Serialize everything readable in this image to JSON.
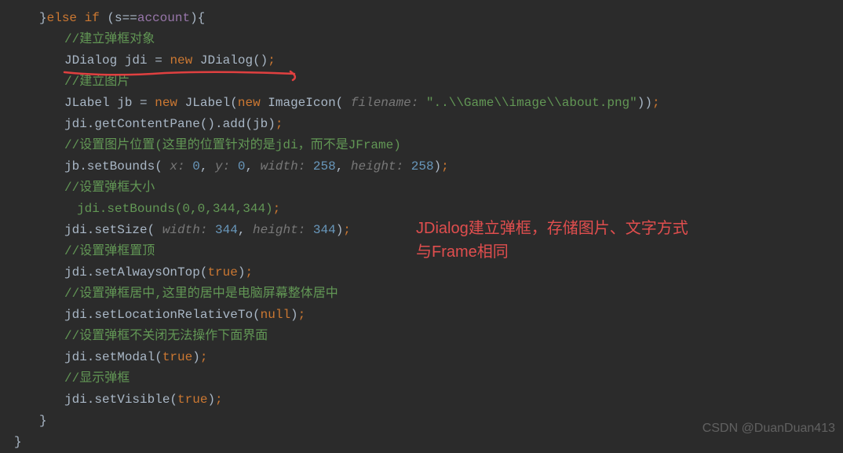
{
  "code": {
    "l1_brace": "}",
    "l1_else": "else if",
    "l1_cond": " (s==",
    "l1_account": "account",
    "l1_close": "){",
    "l2_comment": "//建立弹框对象",
    "l3_type": "JDialog",
    "l3_var": " jdi ",
    "l3_eq": "=",
    "l3_new": " new ",
    "l3_class": "JDialog()",
    "l3_semi": ";",
    "l4_comment": "//建立图片",
    "l5_type": "JLabel",
    "l5_var": " jb ",
    "l5_eq": "=",
    "l5_new": " new ",
    "l5_class": "JLabel(",
    "l5_new2": "new ",
    "l5_icon": "ImageIcon(",
    "l5_hint": " filename: ",
    "l5_str": "\"..\\\\Game\\\\image\\\\about.png\"",
    "l5_close": "))",
    "l5_semi": ";",
    "l6_call": "jdi.getContentPane().add(jb)",
    "l6_semi": ";",
    "l7_comment_a": "//设置图片位置(这里的位置针对的是jdi，而不是",
    "l7_comment_b": "JFrame",
    "l7_comment_c": ")",
    "l8_call": "jb.setBounds(",
    "l8_hx": " x: ",
    "l8_vx": "0",
    "l8_c1": ",",
    "l8_hy": " y: ",
    "l8_vy": "0",
    "l8_c2": ",",
    "l8_hw": " width: ",
    "l8_vw": "258",
    "l8_c3": ",",
    "l8_hh": " height: ",
    "l8_vh": "258",
    "l8_close": ")",
    "l8_semi": ";",
    "l9_comment": "//设置弹框大小",
    "l10_call": "jdi.setBounds(0,0,344,344)",
    "l10_semi": ";",
    "l11_call": "jdi.setSize(",
    "l11_hw": " width: ",
    "l11_vw": "344",
    "l11_c1": ",",
    "l11_hh": " height: ",
    "l11_vh": "344",
    "l11_close": ")",
    "l11_semi": ";",
    "l12_comment": "//设置弹框置顶",
    "l13_call": "jdi.setAlwaysOnTop(",
    "l13_true": "true",
    "l13_close": ")",
    "l13_semi": ";",
    "l14_comment": "//设置弹框居中,这里的居中是电脑屏幕整体居中",
    "l15_call": "jdi.setLocationRelativeTo(",
    "l15_null": "null",
    "l15_close": ")",
    "l15_semi": ";",
    "l16_comment": "//设置弹框不关闭无法操作下面界面",
    "l17_call": "jdi.setModal(",
    "l17_true": "true",
    "l17_close": ")",
    "l17_semi": ";",
    "l18_comment": "//显示弹框",
    "l19_call": "jdi.setVisible(",
    "l19_true": "true",
    "l19_close": ")",
    "l19_semi": ";",
    "l20_brace": "}",
    "l21_brace": "}"
  },
  "annotation": {
    "line1": "JDialog建立弹框，存储图片、文字方式",
    "line2": "与Frame相同"
  },
  "watermark": "CSDN @DuanDuan413"
}
